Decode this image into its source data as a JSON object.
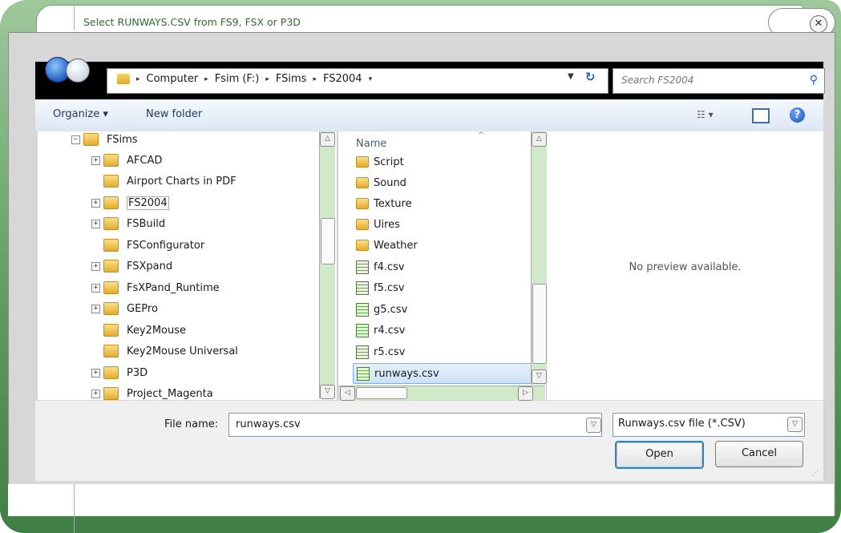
{
  "window": {
    "title": "Select RUNWAYS.CSV from FS9, FSX or P3D",
    "close_glyph": "✕"
  },
  "address": {
    "crumbs": [
      "Computer",
      "Fsim (F:)",
      "FSims",
      "FS2004"
    ],
    "search_placeholder": "Search FS2004"
  },
  "toolbar": {
    "organize_label": "Organize ▾",
    "new_folder_label": "New folder",
    "views_glyph": "☷ ▾",
    "help_glyph": "?"
  },
  "tree": {
    "items": [
      {
        "label": "FSims",
        "expander": "−",
        "level": 0
      },
      {
        "label": "AFCAD",
        "expander": "+",
        "level": 1
      },
      {
        "label": "Airport Charts in PDF",
        "expander": "",
        "level": 1
      },
      {
        "label": "FS2004",
        "expander": "+",
        "level": 1,
        "selected": true
      },
      {
        "label": "FSBuild",
        "expander": "+",
        "level": 1
      },
      {
        "label": "FSConfigurator",
        "expander": "",
        "level": 1
      },
      {
        "label": "FSXpand",
        "expander": "+",
        "level": 1
      },
      {
        "label": "FsXPand_Runtime",
        "expander": "+",
        "level": 1
      },
      {
        "label": "GEPro",
        "expander": "+",
        "level": 1
      },
      {
        "label": "Key2Mouse",
        "expander": "",
        "level": 1
      },
      {
        "label": "Key2Mouse Universal",
        "expander": "",
        "level": 1
      },
      {
        "label": "P3D",
        "expander": "+",
        "level": 1
      },
      {
        "label": "Project_Magenta",
        "expander": "+",
        "level": 1
      }
    ]
  },
  "files": {
    "column_name": "Name",
    "sort_glyph": "^",
    "items": [
      {
        "name": "Script",
        "type": "folder"
      },
      {
        "name": "Sound",
        "type": "folder"
      },
      {
        "name": "Texture",
        "type": "folder"
      },
      {
        "name": "Uires",
        "type": "folder"
      },
      {
        "name": "Weather",
        "type": "folder"
      },
      {
        "name": "f4.csv",
        "type": "csv"
      },
      {
        "name": "f5.csv",
        "type": "csv"
      },
      {
        "name": "g5.csv",
        "type": "csv"
      },
      {
        "name": "r4.csv",
        "type": "csv"
      },
      {
        "name": "r5.csv",
        "type": "csv"
      },
      {
        "name": "runways.csv",
        "type": "csv",
        "selected": true
      }
    ]
  },
  "preview": {
    "text": "No preview available."
  },
  "bottom": {
    "filename_label": "File name:",
    "filename_value": "runways.csv",
    "filter_value": "Runways.csv file (*.CSV)",
    "open_label": "Open",
    "cancel_label": "Cancel"
  },
  "colors": {
    "frame_green": "#5f9f63",
    "title_green": "#2d6e2d",
    "selection_blue": "#cde1f6",
    "scrollbar_green": "#cfe9c9"
  }
}
